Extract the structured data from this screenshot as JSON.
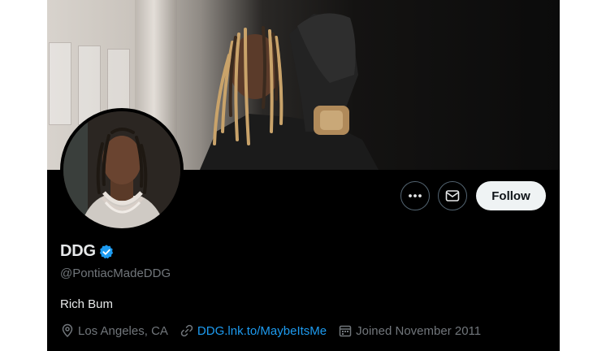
{
  "profile": {
    "display_name": "DDG",
    "handle": "@PontiacMadeDDG",
    "bio": "Rich Bum",
    "location": "Los Angeles, CA",
    "website": "DDG.lnk.to/MaybeItsMe",
    "joined": "Joined November 2011",
    "verified": true
  },
  "actions": {
    "more_icon": "more-dots-icon",
    "message_icon": "envelope-icon",
    "follow_label": "Follow"
  },
  "colors": {
    "background": "#000000",
    "primary_text": "#e7e9ea",
    "secondary_text": "#71767b",
    "link": "#1d9bf0",
    "verified_badge": "#1d9bf0",
    "follow_button_bg": "#eff3f4"
  }
}
